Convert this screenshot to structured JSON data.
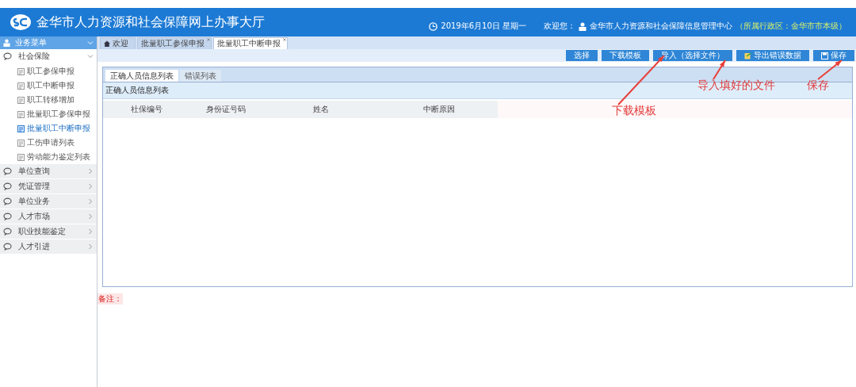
{
  "header": {
    "title": "金华市人力资源和社会保障网上办事大厅",
    "date": "2019年6月10日 星期一",
    "welcome": "欢迎您：",
    "user": "金华市人力资源和社会保障信息管理中心",
    "region": "（所属行政区：金华市市本级）"
  },
  "sidebar": {
    "title": "业务菜单",
    "groups": [
      {
        "label": "社会保险",
        "expanded": true,
        "children": [
          {
            "label": "职工参保申报",
            "selected": false
          },
          {
            "label": "职工中断申报",
            "selected": false
          },
          {
            "label": "职工转移增加",
            "selected": false
          },
          {
            "label": "批量职工参保申报",
            "selected": false
          },
          {
            "label": "批量职工中断申报",
            "selected": true
          },
          {
            "label": "工伤申请列表",
            "selected": false
          },
          {
            "label": "劳动能力鉴定列表",
            "selected": false
          }
        ]
      },
      {
        "label": "单位查询",
        "expanded": false
      },
      {
        "label": "凭证管理",
        "expanded": false
      },
      {
        "label": "单位业务",
        "expanded": false
      },
      {
        "label": "人才市场",
        "expanded": false
      },
      {
        "label": "职业技能鉴定",
        "expanded": false
      },
      {
        "label": "人才引进",
        "expanded": false
      }
    ]
  },
  "tabs": [
    {
      "label": "欢迎",
      "kind": "home",
      "selected": false
    },
    {
      "label": "批量职工参保申报",
      "kind": "closable",
      "selected": false
    },
    {
      "label": "批量职工中断申报",
      "kind": "closable",
      "selected": true
    }
  ],
  "toolbar": [
    {
      "label": "选择",
      "kind": "plain"
    },
    {
      "label": "下载模板",
      "kind": "plain"
    },
    {
      "label": "导入（选择文件）",
      "kind": "plain"
    },
    {
      "label": "导出错误数据",
      "kind": "export"
    },
    {
      "label": "保存",
      "kind": "save"
    }
  ],
  "inner_tabs": [
    {
      "label": "正确人员信息列表",
      "selected": true
    },
    {
      "label": "错误列表",
      "selected": false
    }
  ],
  "panel_title": "正确人员信息列表",
  "table": {
    "columns": [
      "社保编号",
      "身份证号码",
      "姓名",
      "中断原因"
    ]
  },
  "remark_label": "备注：",
  "annotations": [
    {
      "text": "下载模板"
    },
    {
      "text": "导入填好的文件"
    },
    {
      "text": "保存"
    }
  ]
}
